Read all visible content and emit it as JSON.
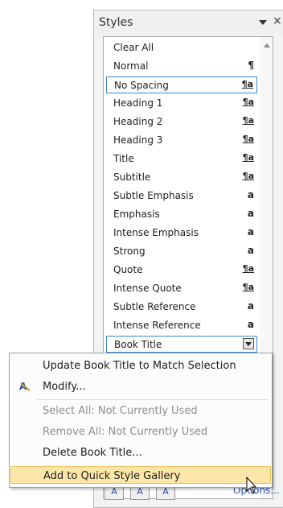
{
  "pane": {
    "title": "Styles",
    "close_glyph": "×",
    "styles": [
      {
        "name": "Clear All",
        "glyph": ""
      },
      {
        "name": "Normal",
        "glyph": "¶"
      },
      {
        "name": "No Spacing",
        "glyph": "¶a"
      },
      {
        "name": "Heading 1",
        "glyph": "¶a"
      },
      {
        "name": "Heading 2",
        "glyph": "¶a"
      },
      {
        "name": "Heading 3",
        "glyph": "¶a"
      },
      {
        "name": "Title",
        "glyph": "¶a"
      },
      {
        "name": "Subtitle",
        "glyph": "¶a"
      },
      {
        "name": "Subtle Emphasis",
        "glyph": "a"
      },
      {
        "name": "Emphasis",
        "glyph": "a"
      },
      {
        "name": "Intense Emphasis",
        "glyph": "a"
      },
      {
        "name": "Strong",
        "glyph": "a"
      },
      {
        "name": "Quote",
        "glyph": "¶a"
      },
      {
        "name": "Intense Quote",
        "glyph": "¶a"
      },
      {
        "name": "Subtle Reference",
        "glyph": "a"
      },
      {
        "name": "Intense Reference",
        "glyph": "a"
      },
      {
        "name": "Book Title",
        "glyph": ""
      }
    ],
    "toolbar": {
      "new_style_glyph": "A",
      "inspector_glyph": "A",
      "manage_glyph": "A",
      "options_label": "Options..."
    }
  },
  "context_menu": {
    "items": [
      {
        "label": "Update Book Title to Match Selection",
        "enabled": true
      },
      {
        "label": "Modify...",
        "enabled": true,
        "icon": "modify-style-icon"
      },
      {
        "label": "Select All: Not Currently Used",
        "enabled": false
      },
      {
        "label": "Remove All: Not Currently Used",
        "enabled": false
      },
      {
        "label": "Delete Book Title...",
        "enabled": true
      },
      {
        "label": "Add to Quick Style Gallery",
        "enabled": true,
        "highlighted": true
      }
    ]
  },
  "colors": {
    "selection_border": "#3b86d4",
    "menu_highlight": "#fce7a8",
    "link": "#2b5ab5"
  }
}
